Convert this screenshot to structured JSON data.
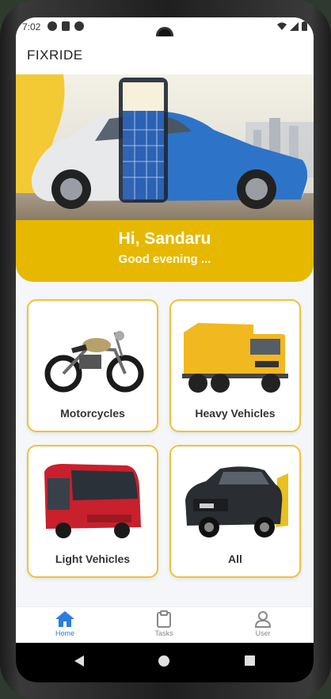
{
  "status": {
    "time": "7:02"
  },
  "app": {
    "title": "FIXRIDE"
  },
  "hero": {
    "greeting": "Hi, Sandaru",
    "subtitle": "Good evening ..."
  },
  "categories": [
    {
      "label": "Motorcycles",
      "icon": "motorcycle-image"
    },
    {
      "label": "Heavy Vehicles",
      "icon": "truck-image"
    },
    {
      "label": "Light Vehicles",
      "icon": "bus-image"
    },
    {
      "label": "All",
      "icon": "suv-image"
    }
  ],
  "nav": [
    {
      "label": "Home",
      "icon": "home-icon",
      "active": true
    },
    {
      "label": "Tasks",
      "icon": "clipboard-icon",
      "active": false
    },
    {
      "label": "User",
      "icon": "user-icon",
      "active": false
    }
  ],
  "colors": {
    "accent": "#e7b800",
    "card_border": "#f0c23a",
    "active": "#2a7de1"
  }
}
